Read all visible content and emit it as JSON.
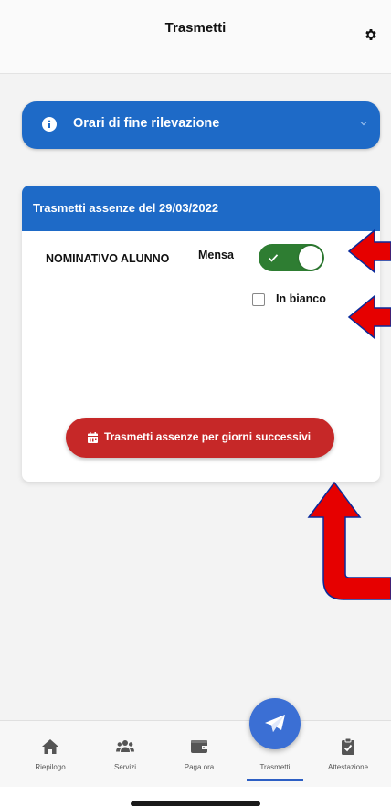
{
  "header": {
    "title": "Trasmetti",
    "settings_icon": "gear-icon"
  },
  "accordion": {
    "label": "Orari di fine rilevazione",
    "icon": "info-icon",
    "chevron": "chevron-down-icon"
  },
  "card": {
    "title": "Trasmetti assenze del 29/03/2022",
    "student_label": "NOMINATIVO ALUNNO",
    "mensa_label": "Mensa",
    "mensa_on": true,
    "blank_label": "In bianco",
    "blank_checked": false,
    "button_label": "Trasmetti assenze per giorni successivi",
    "button_icon": "calendar-icon"
  },
  "nav": {
    "items": [
      {
        "label": "Riepilogo",
        "icon": "home-icon"
      },
      {
        "label": "Servizi",
        "icon": "users-icon"
      },
      {
        "label": "Paga ora",
        "icon": "wallet-icon"
      },
      {
        "label": "Trasmetti",
        "icon": "send-icon",
        "active": true
      },
      {
        "label": "Attestazione",
        "icon": "clipboard-check-icon"
      }
    ]
  },
  "colors": {
    "primary": "#1e6ac7",
    "danger": "#c62828",
    "toggle_on": "#2e7d32",
    "fab": "#3b6fd4",
    "annotation_arrow": "#e60000"
  }
}
